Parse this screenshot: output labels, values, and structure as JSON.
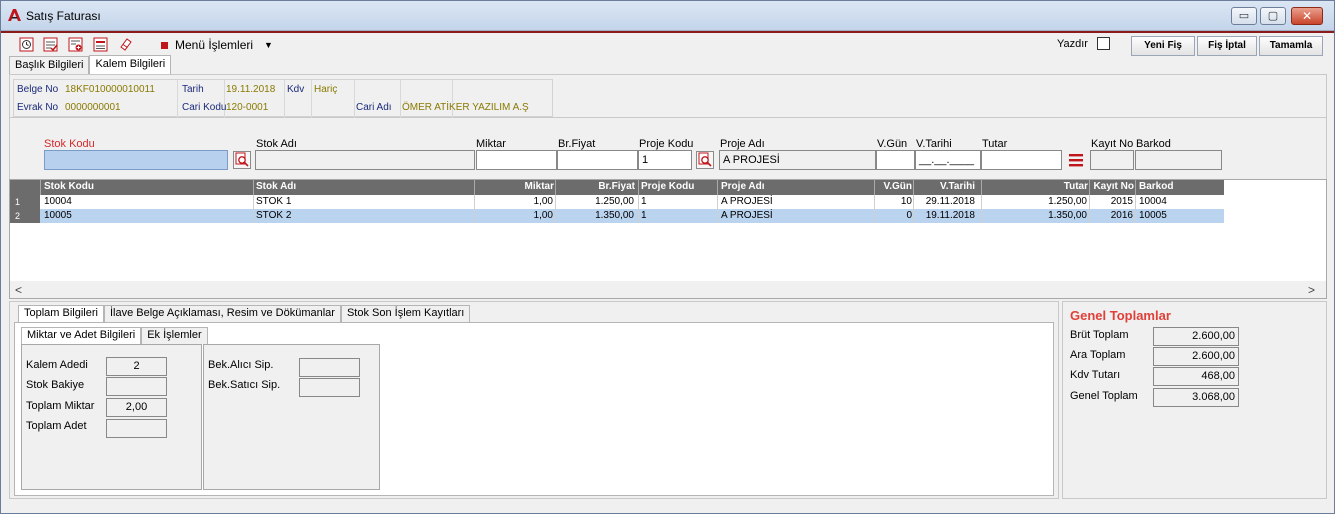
{
  "window": {
    "title": "Satış Faturası",
    "controls": {
      "minimize": "▭",
      "maximize": "▢",
      "close": "✕"
    }
  },
  "toolbar": {
    "icons": [
      "clock-icon",
      "checklist-icon",
      "add-document-icon",
      "list-document-icon",
      "eraser-icon"
    ],
    "menu_label": "Menü İşlemleri",
    "menu_arrow": "▼",
    "print_label": "Yazdır",
    "print_checked": false,
    "buttons": {
      "new": "Yeni Fiş",
      "cancel": "Fiş İptal",
      "complete": "Tamamla"
    }
  },
  "tabs": {
    "header": "Başlık Bilgileri",
    "items": "Kalem Bilgileri",
    "active": "items"
  },
  "header_info": {
    "belge_no_label": "Belge No",
    "belge_no": "18KF010000010011",
    "evrak_no_label": "Evrak No",
    "evrak_no": "0000000001",
    "tarih_label": "Tarih",
    "tarih": "19.11.2018",
    "kdv_label": "Kdv",
    "kdv": "Hariç",
    "cari_kodu_label": "Cari Kodu",
    "cari_kodu": "120-0001",
    "cari_adi_label": "Cari Adı",
    "cari_adi": "ÖMER ATİKER YAZILIM A.Ş"
  },
  "entry": {
    "stok_kodu": "Stok Kodu",
    "stok_adi": "Stok Adı",
    "miktar": "Miktar",
    "br_fiyat": "Br.Fiyat",
    "proje_kodu": "Proje Kodu",
    "proje_adi": "Proje Adı",
    "v_gun": "V.Gün",
    "v_tarihi": "V.Tarihi",
    "tutar": "Tutar",
    "kayit_no": "Kayıt No",
    "barkod": "Barkod",
    "proje_kodu_value": "1",
    "proje_adi_value": "A PROJESİ",
    "v_tarihi_value": "__.__.____",
    "stok_kodu_color": "#d42a2a"
  },
  "grid": {
    "columns": [
      "Stok Kodu",
      "Stok Adı",
      "Miktar",
      "Br.Fiyat",
      "Proje Kodu",
      "Proje Adı",
      "V.Gün",
      "V.Tarihi",
      "Tutar",
      "Kayıt No",
      "Barkod"
    ],
    "rows": [
      {
        "num": "1",
        "stok_kodu": "10004",
        "stok_adi": "STOK 1",
        "miktar": "1,00",
        "br_fiyat": "1.250,00",
        "proje_kodu": "1",
        "proje_adi": "A PROJESİ",
        "v_gun": "10",
        "v_tarihi": "29.11.2018",
        "tutar": "1.250,00",
        "kayit_no": "2015",
        "barkod": "10004"
      },
      {
        "num": "2",
        "stok_kodu": "10005",
        "stok_adi": "STOK 2",
        "miktar": "1,00",
        "br_fiyat": "1.350,00",
        "proje_kodu": "1",
        "proje_adi": "A PROJESİ",
        "v_gun": "0",
        "v_tarihi": "19.11.2018",
        "tutar": "1.350,00",
        "kayit_no": "2016",
        "barkod": "10005"
      }
    ],
    "selected_row": 2,
    "scroll_left": "<",
    "scroll_right": ">"
  },
  "bottom_tabs": {
    "totals": "Toplam Bilgileri",
    "attachments": "İlave Belge Açıklaması, Resim ve Dökümanlar",
    "history": "Stok Son İşlem Kayıtları"
  },
  "sub_tabs": {
    "quantity": "Miktar ve Adet Bilgileri",
    "extra": "Ek İşlemler"
  },
  "quantity": {
    "kalem_adedi_label": "Kalem Adedi",
    "kalem_adedi": "2",
    "stok_bakiye_label": "Stok Bakiye",
    "stok_bakiye": "",
    "toplam_miktar_label": "Toplam Miktar",
    "toplam_miktar": "2,00",
    "toplam_adet_label": "Toplam Adet",
    "toplam_adet": "",
    "bek_alici_label": "Bek.Alıcı Sip.",
    "bek_alici": "",
    "bek_satici_label": "Bek.Satıcı Sip.",
    "bek_satici": ""
  },
  "totals": {
    "title": "Genel Toplamlar",
    "brut_label": "Brüt Toplam",
    "brut": "2.600,00",
    "ara_label": "Ara Toplam",
    "ara": "2.600,00",
    "kdv_label": "Kdv Tutarı",
    "kdv": "468,00",
    "genel_label": "Genel Toplam",
    "genel": "3.068,00"
  }
}
